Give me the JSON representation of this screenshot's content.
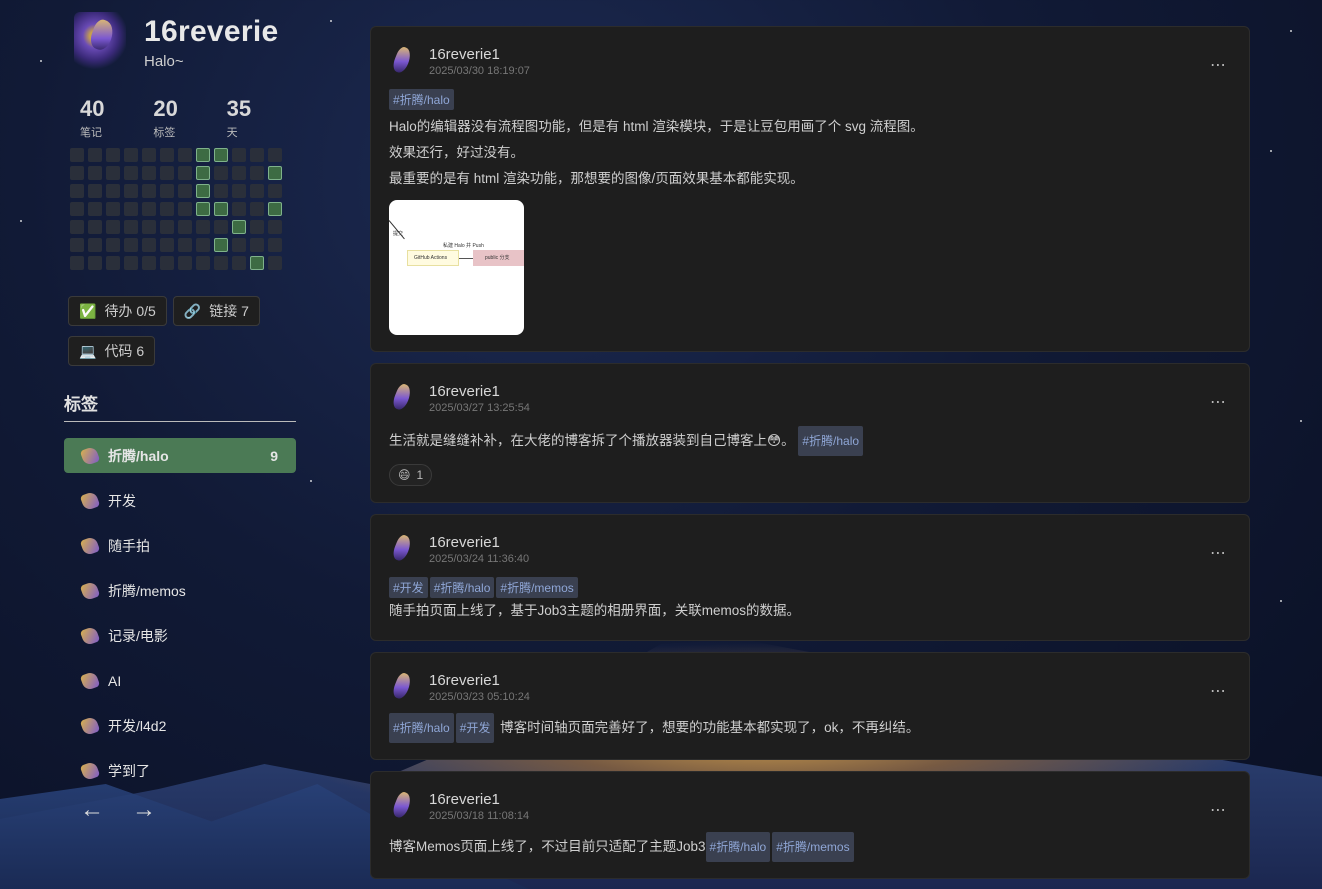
{
  "profile": {
    "name": "16reverie",
    "description": "Halo~"
  },
  "stats": [
    {
      "value": "40",
      "label": "笔记"
    },
    {
      "value": "20",
      "label": "标签"
    },
    {
      "value": "35",
      "label": "天"
    }
  ],
  "heatmap_on": [
    7,
    8,
    19,
    23,
    31,
    43,
    44,
    47,
    57,
    68,
    82,
    86
  ],
  "chips": [
    {
      "icon": "✅",
      "label": "待办 0/5"
    },
    {
      "icon": "🔗",
      "label": "链接 7"
    },
    {
      "icon": "💻",
      "label": "代码 6"
    }
  ],
  "tags_section": {
    "title": "标签",
    "items": [
      {
        "name": "折腾/halo",
        "count": "9",
        "active": true
      },
      {
        "name": "开发",
        "count": ""
      },
      {
        "name": "随手拍",
        "count": ""
      },
      {
        "name": "折腾/memos",
        "count": ""
      },
      {
        "name": "记录/电影",
        "count": ""
      },
      {
        "name": "AI",
        "count": ""
      },
      {
        "name": "开发/l4d2",
        "count": ""
      },
      {
        "name": "学到了",
        "count": ""
      }
    ]
  },
  "pager": {
    "prev": "←",
    "next": "→"
  },
  "posts": [
    {
      "author": "16reverie1",
      "date": "2025/03/30 18:19:07",
      "tags": [
        "#折腾/halo"
      ],
      "lines": [
        "Halo的编辑器没有流程图功能，但是有 html 渲染模块，于是让豆包用画了个 svg 流程图。",
        "效果还行，好过没有。",
        "最重要的是有 html 渲染功能，那想要的图像/页面效果基本都能实现。"
      ],
      "thumb": {
        "label_top": "私建 Halo 并 Push",
        "box1": "GitHub Actions",
        "box2": "public 分支",
        "side": "提交"
      }
    },
    {
      "author": "16reverie1",
      "date": "2025/03/27 13:25:54",
      "text": "生活就是缝缝补补，在大佬的博客拆了个播放器装到自己博客上😳。",
      "tags_after": [
        "#折腾/halo"
      ],
      "reaction": {
        "emoji": "😄",
        "count": "1"
      }
    },
    {
      "author": "16reverie1",
      "date": "2025/03/24 11:36:40",
      "tags": [
        "#开发",
        "#折腾/halo",
        "#折腾/memos"
      ],
      "text": "随手拍页面上线了，基于Job3主题的相册界面，关联memos的数据。"
    },
    {
      "author": "16reverie1",
      "date": "2025/03/23 05:10:24",
      "tags_inline": [
        "#折腾/halo",
        "#开发"
      ],
      "text": "博客时间轴页面完善好了，想要的功能基本都实现了，ok，不再纠结。"
    },
    {
      "author": "16reverie1",
      "date": "2025/03/18 11:08:14",
      "text": "博客Memos页面上线了，不过目前只适配了主题Job3",
      "tags_after": [
        "#折腾/halo",
        "#折腾/memos"
      ]
    }
  ],
  "more_icon": "⋯"
}
